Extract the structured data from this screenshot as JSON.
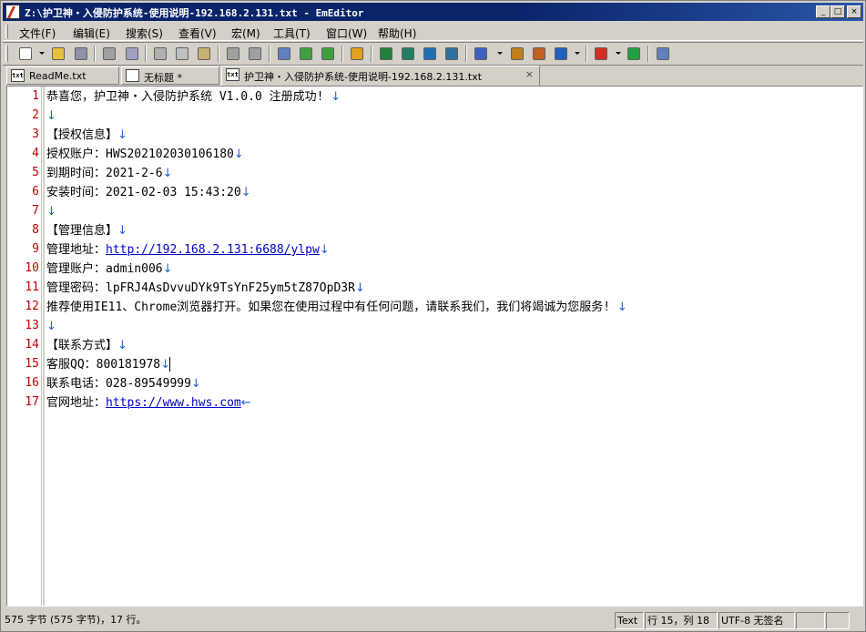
{
  "window": {
    "title": "Z:\\护卫神・入侵防护系统-使用说明-192.168.2.131.txt - EmEditor"
  },
  "title_buttons": {
    "minimize": "_",
    "maximize": "□",
    "close": "×"
  },
  "menu": {
    "items": [
      "文件(F)",
      "编辑(E)",
      "搜索(S)",
      "查看(V)",
      "宏(M)",
      "工具(T)",
      "窗口(W)",
      "帮助(H)"
    ]
  },
  "toolbar": {
    "buttons": [
      {
        "icon": "new-file-icon",
        "color": "#ffffff"
      },
      {
        "icon": "open-folder-icon",
        "color": "#e8c040"
      },
      {
        "icon": "save-icon",
        "color": "#9090a8"
      },
      {
        "icon": "print-icon",
        "color": "#a0a0a0"
      },
      {
        "icon": "print-preview-icon",
        "color": "#a0a0c0"
      },
      {
        "icon": "cut-icon",
        "color": "#b0b0b0"
      },
      {
        "icon": "copy-icon",
        "color": "#c0c0c0"
      },
      {
        "icon": "paste-icon",
        "color": "#c8b070"
      },
      {
        "icon": "undo-icon",
        "color": "#a0a0a0"
      },
      {
        "icon": "redo-icon",
        "color": "#a0a0a0"
      },
      {
        "icon": "find-icon",
        "color": "#6080c0"
      },
      {
        "icon": "find-next-icon",
        "color": "#40a040"
      },
      {
        "icon": "find-previous-icon",
        "color": "#40a040"
      },
      {
        "icon": "highlight-icon",
        "color": "#e0a020"
      },
      {
        "icon": "view-mode-1-icon",
        "color": "#208040"
      },
      {
        "icon": "view-mode-2-icon",
        "color": "#208060"
      },
      {
        "icon": "view-mode-3-icon",
        "color": "#2070b0"
      },
      {
        "icon": "view-mode-4-icon",
        "color": "#3070a0"
      },
      {
        "icon": "configuration-icon",
        "color": "#4060c0"
      },
      {
        "icon": "properties-icon",
        "color": "#c08020"
      },
      {
        "icon": "customize-icon",
        "color": "#c06020"
      },
      {
        "icon": "checklist-icon",
        "color": "#2060c0"
      },
      {
        "icon": "stop-record-icon",
        "color": "#d03020"
      },
      {
        "icon": "run-macro-icon",
        "color": "#20a040"
      },
      {
        "icon": "tools-icon",
        "color": "#6080c0"
      }
    ]
  },
  "tabs": [
    {
      "icon": "txt",
      "label": "ReadMe.txt",
      "active": false,
      "closable": false
    },
    {
      "icon": "",
      "label": "无标题 *",
      "active": false,
      "closable": false
    },
    {
      "icon": "txt",
      "label": "护卫神・入侵防护系统-使用说明-192.168.2.131.txt",
      "active": true,
      "closable": true,
      "close_glyph": "×"
    }
  ],
  "editor": {
    "eol_marker": "↓",
    "eof_marker": "←",
    "lines": [
      {
        "n": "1",
        "text": "恭喜您，护卫神・入侵防护系统 V1.0.0 注册成功! ",
        "link": "",
        "eol": "↓"
      },
      {
        "n": "2",
        "text": "",
        "link": "",
        "eol": "↓"
      },
      {
        "n": "3",
        "text": "【授权信息】",
        "link": "",
        "eol": "↓"
      },
      {
        "n": "4",
        "text": "授权账户：HWS202102030106180",
        "link": "",
        "eol": "↓"
      },
      {
        "n": "5",
        "text": "到期时间：2021-2-6",
        "link": "",
        "eol": "↓"
      },
      {
        "n": "6",
        "text": "安装时间：2021-02-03 15:43:20",
        "link": "",
        "eol": "↓"
      },
      {
        "n": "7",
        "text": "",
        "link": "",
        "eol": "↓"
      },
      {
        "n": "8",
        "text": "【管理信息】",
        "link": "",
        "eol": "↓"
      },
      {
        "n": "9",
        "text": "管理地址：",
        "link": "http://192.168.2.131:6688/ylpw",
        "eol": "↓"
      },
      {
        "n": "10",
        "text": "管理账户：admin006",
        "link": "",
        "eol": "↓"
      },
      {
        "n": "11",
        "text": "管理密码：lpFRJ4AsDvvuDYk9TsYnF25ym5tZ87OpD3R",
        "link": "",
        "eol": "↓"
      },
      {
        "n": "12",
        "text": "推荐使用IE11、Chrome浏览器打开。如果您在使用过程中有任何问题，请联系我们，我们将竭诚为您服务! ",
        "link": "",
        "eol": "↓"
      },
      {
        "n": "13",
        "text": "",
        "link": "",
        "eol": "↓"
      },
      {
        "n": "14",
        "text": "【联系方式】",
        "link": "",
        "eol": "↓"
      },
      {
        "n": "15",
        "text": "客服QQ：800181978",
        "link": "",
        "eol": "↓"
      },
      {
        "n": "16",
        "text": "联系电话：028-89549999",
        "link": "",
        "eol": "↓"
      },
      {
        "n": "17",
        "text": "官网地址：",
        "link": "https://www.hws.com",
        "eol": "←"
      }
    ]
  },
  "status": {
    "left": "575 字节 (575 字节)，17 行。",
    "mode": "Text",
    "position": "行 15，列 18",
    "encoding": "UTF-8 无签名"
  }
}
